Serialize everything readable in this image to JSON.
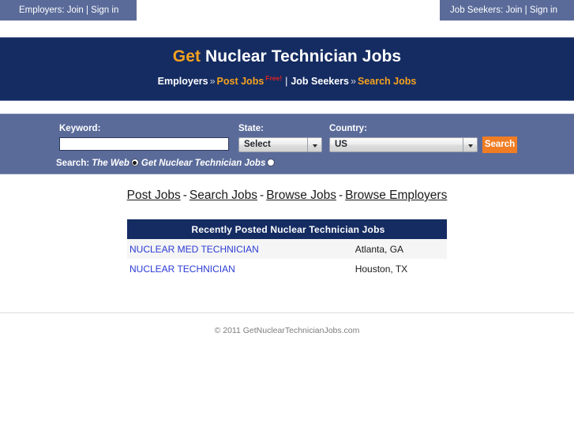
{
  "topbar": {
    "employers_tab": "Employers: Join | Sign in",
    "jobseekers_tab": "Job Seekers: Join | Sign in"
  },
  "header": {
    "title_accent": "Get",
    "title_rest": " Nuclear Technician Jobs",
    "nav": {
      "employers": "Employers",
      "chevron1": "»",
      "post_jobs": "Post Jobs",
      "free_badge": "Free!",
      "pipe": "|",
      "job_seekers": "Job Seekers",
      "chevron2": "»",
      "search_jobs": "Search Jobs"
    }
  },
  "search": {
    "keyword_label": "Keyword:",
    "keyword_value": "",
    "keyword_placeholder": "",
    "state_label": "State:",
    "state_value": "Select",
    "country_label": "Country:",
    "country_value": "US",
    "search_button": "Search",
    "scope_prefix": "Search:",
    "scope_option_web": "The Web",
    "scope_option_site": "Get Nuclear Technician Jobs",
    "scope_selected": "The Web"
  },
  "quicklinks": {
    "sep": "-",
    "items": [
      {
        "label": "Post Jobs"
      },
      {
        "label": "Search Jobs"
      },
      {
        "label": "Browse Jobs"
      },
      {
        "label": "Browse Employers"
      }
    ]
  },
  "jobs": {
    "title": "Recently Posted Nuclear Technician Jobs",
    "rows": [
      {
        "title": "NUCLEAR MED TECHNICIAN",
        "location": "Atlanta, GA"
      },
      {
        "title": "NUCLEAR TECHNICIAN",
        "location": "Houston, TX"
      }
    ]
  },
  "footer": {
    "copyright": "© 2011 GetNuclearTechnicianJobs.com"
  },
  "colors": {
    "navy": "#152c62",
    "slate_blue": "#5a6b9a",
    "accent_orange": "#f5a21e",
    "button_orange": "#f07d24",
    "link_blue": "#2b3bd4",
    "free_red": "#e02020"
  }
}
